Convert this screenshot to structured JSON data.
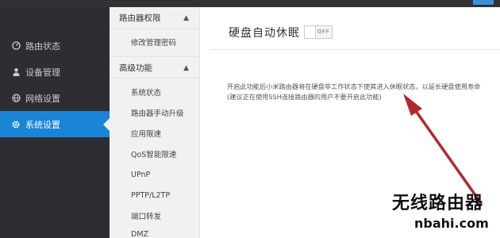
{
  "sidebar": {
    "items": [
      {
        "label": "路由状态",
        "icon": "dashboard-icon"
      },
      {
        "label": "设备管理",
        "icon": "user-icon"
      },
      {
        "label": "网络设置",
        "icon": "globe-icon"
      },
      {
        "label": "系统设置",
        "icon": "gear-icon",
        "active": true
      }
    ]
  },
  "submenu": {
    "groups": [
      {
        "title": "路由器权限",
        "items": [
          "修改管理密码"
        ]
      },
      {
        "title": "高级功能",
        "items": [
          "系统状态",
          "路由器手动升级",
          "应用限速",
          "QoS智能限速",
          "UPnP",
          "PPTP/L2TP",
          "端口转发",
          "DMZ"
        ]
      }
    ]
  },
  "main": {
    "title": "硬盘自动休眠",
    "toggle": {
      "state_label": "OFF",
      "on": false
    },
    "desc_line1": "开启此功能后小米路由器将在硬盘非工作状态下使其进入休眠状态，以延长硬盘使用寿命",
    "desc_line2": "(建议正在使用SSH连接路由器的用户不要开启此功能)"
  },
  "watermark": {
    "text": "无线路由器",
    "url": "nbahi.com"
  },
  "colors": {
    "accent": "#1a85d6",
    "sidebar_bg": "#2c2e32",
    "arrow": "#b3282d"
  }
}
